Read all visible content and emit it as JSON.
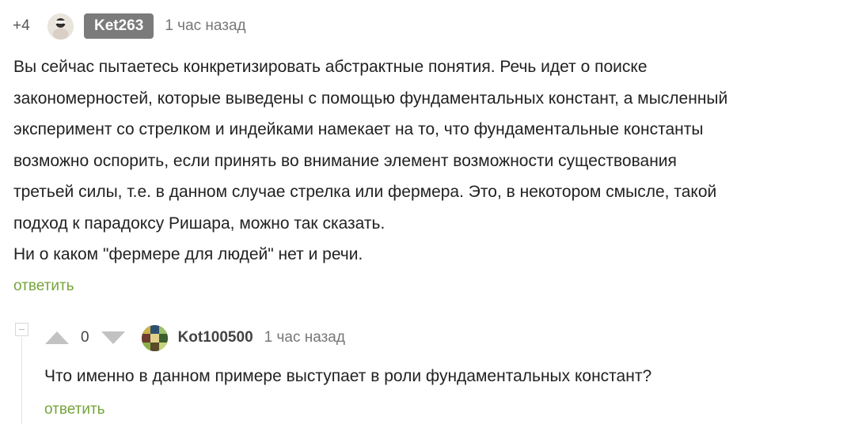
{
  "comment": {
    "rating": "+4",
    "author": "Ket263",
    "time": "1 час назад",
    "avatar_icon": "user-avatar-icon",
    "lines": [
      "Вы сейчас пытаетесь конкретизировать абстрактные понятия. Речь идет о поиске",
      "закономерностей, которые выведены с помощью фундаментальных констант, а мысленный",
      "эксперимент со стрелком и индейками намекает на то, что фундаментальные константы",
      "возможно оспорить, если принять во внимание элемент возможности существования",
      "третьей силы, т.е. в данном случае стрелка или фермера. Это, в некотором смысле, такой",
      "подход к парадоксу Ришара, можно так сказать.",
      "Ни о каком \"фермере для людей\" нет и речи."
    ],
    "reply_label": "ответить"
  },
  "reply": {
    "rating": "0",
    "author": "Kot100500",
    "time": "1 час назад",
    "avatar_icon": "user-avatar-icon",
    "text": "Что именно в данном примере выступает в роли фундаментальных констант?",
    "reply_label": "ответить"
  },
  "colors": {
    "accent_green": "#76a43b",
    "badge_gray": "#7b7b7b",
    "vote_arrow": "#c2c2c2"
  }
}
